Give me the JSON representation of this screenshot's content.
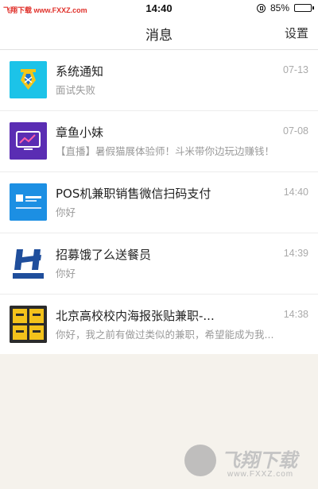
{
  "status_bar": {
    "watermark": "飞翔下载 www.FXXZ.com",
    "time": "14:40",
    "battery": "85%",
    "battery_level": 0.85
  },
  "nav": {
    "title": "消息",
    "settings_label": "设置"
  },
  "messages": [
    {
      "title": "系统通知",
      "preview": "面试失败",
      "time": "07-13",
      "icon": "system-notice-icon",
      "color": "#1cc3e8"
    },
    {
      "title": "章鱼小妹",
      "preview": "【直播】暑假猫展体验师！斗米带你边玩边赚钱！",
      "time": "07-08",
      "icon": "octopus-tv-icon",
      "color": "#5a2db3"
    },
    {
      "title": "POS机兼职销售微信扫码支付",
      "preview": "你好",
      "time": "14:40",
      "icon": "pos-company-logo",
      "color": "#1c8fe3"
    },
    {
      "title": "招募饿了么送餐员",
      "preview": "你好",
      "time": "14:39",
      "icon": "lianhai-company-logo",
      "color": "#1f4e9c"
    },
    {
      "title": "北京高校校内海报张贴兼职-...",
      "preview": "你好，我之前有做过类似的兼职，希望能成为我...",
      "time": "14:38",
      "icon": "laifei-tech-logo",
      "color": "#2b2b2b"
    }
  ],
  "bottom_watermark": {
    "brand": "飞翔下载",
    "url": "www.FXXZ.com"
  }
}
